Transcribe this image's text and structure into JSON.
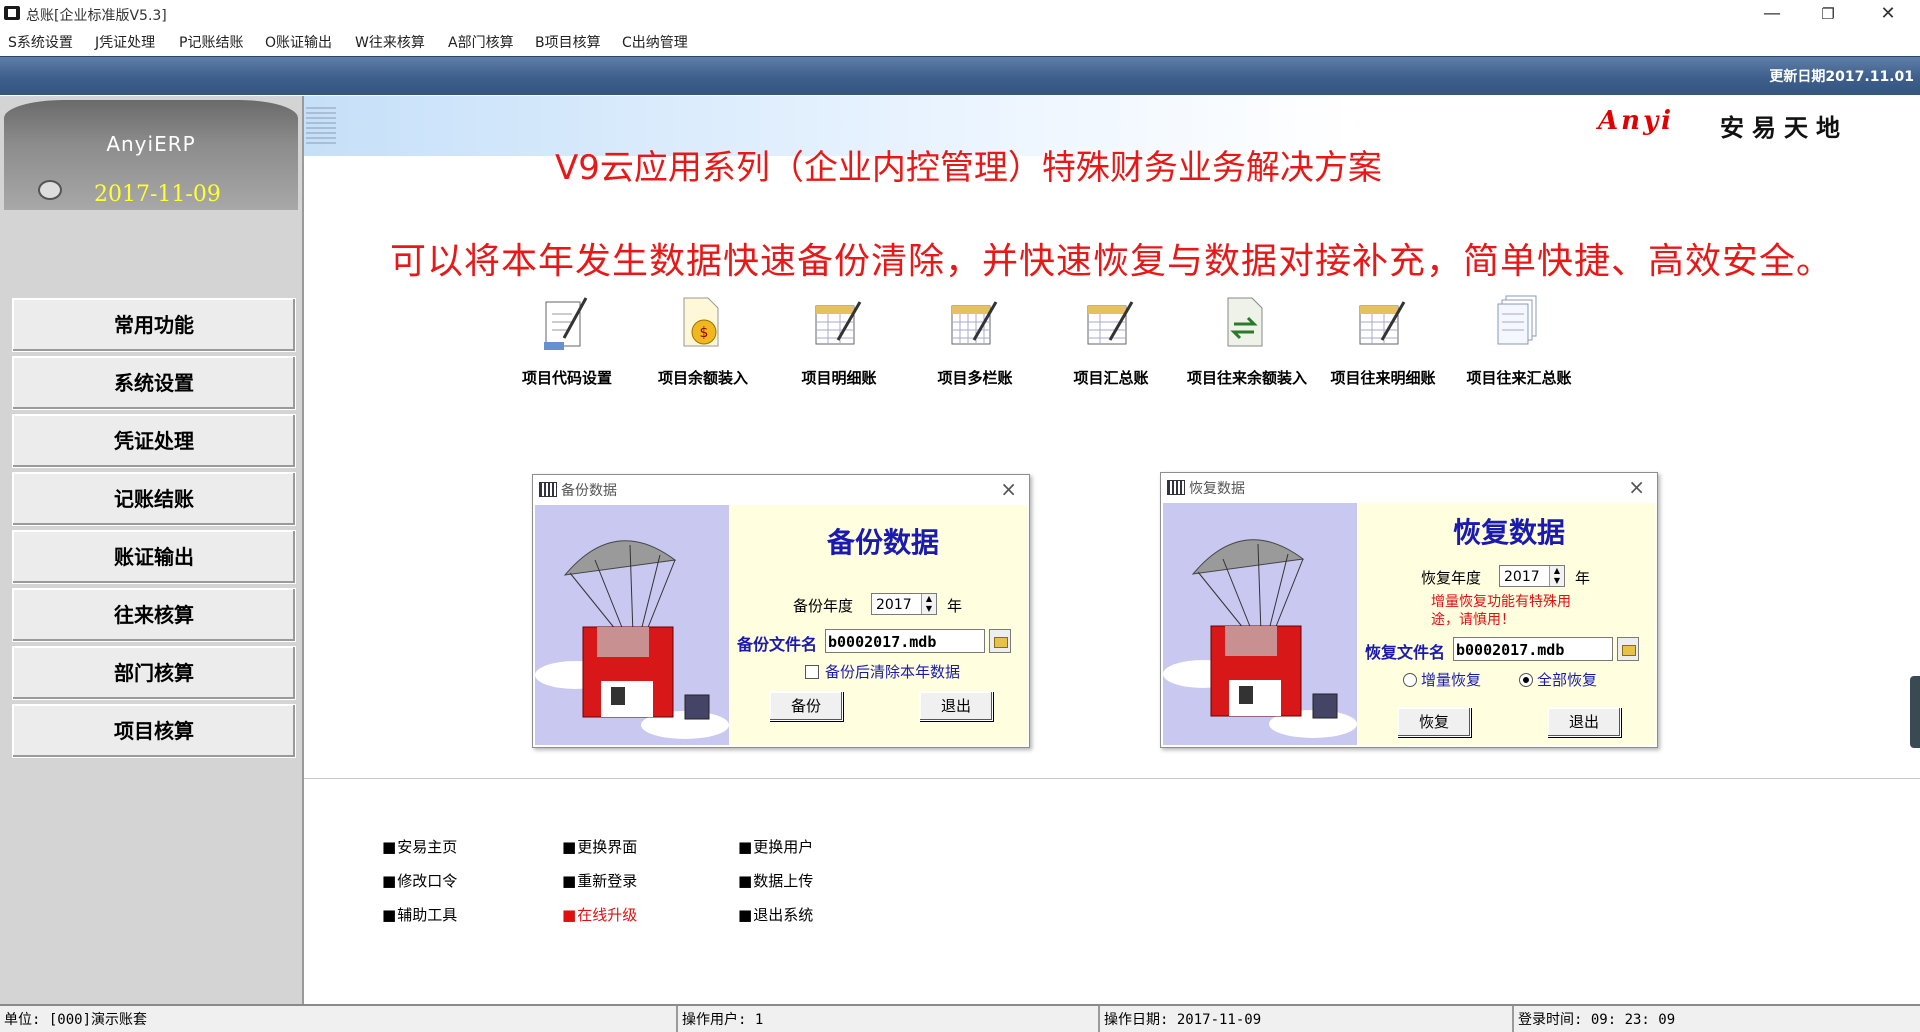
{
  "window": {
    "title": "总账[企业标准版V5.3]",
    "controls": {
      "minimize": "—",
      "restore": "❐",
      "close": "✕"
    }
  },
  "menu": [
    "S系统设置",
    "J凭证处理",
    "P记账结账",
    "O账证输出",
    "W往来核算",
    "A部门核算",
    "B项目核算",
    "C出纳管理"
  ],
  "header": {
    "update_date": "更新日期2017.11.01"
  },
  "sidebar": {
    "brand": "AnyiERP",
    "date": "2017-11-09",
    "items": [
      "常用功能",
      "系统设置",
      "凭证处理",
      "记账结账",
      "账证输出",
      "往来核算",
      "部门核算",
      "项目核算"
    ]
  },
  "banner": {
    "logo_en": "Anyi",
    "logo_cn": "安易天地",
    "headline": "V9云应用系列（企业内控管理）特殊财务业务解决方案",
    "subline": "可以将本年发生数据快速备份清除，并快速恢复与数据对接补充，简单快捷、高效安全。"
  },
  "functions": [
    {
      "label": "项目代码设置",
      "icon": "edit-document-icon"
    },
    {
      "label": "项目余额装入",
      "icon": "money-document-icon"
    },
    {
      "label": "项目明细账",
      "icon": "ledger-icon"
    },
    {
      "label": "项目多栏账",
      "icon": "multi-column-ledger-icon"
    },
    {
      "label": "项目汇总账",
      "icon": "summary-ledger-icon"
    },
    {
      "label": "项目往来余额装入",
      "icon": "transfer-document-icon"
    },
    {
      "label": "项目往来明细账",
      "icon": "ledger-icon"
    },
    {
      "label": "项目往来汇总账",
      "icon": "stacked-documents-icon"
    }
  ],
  "backup_dialog": {
    "title": "备份数据",
    "heading": "备份数据",
    "year_label": "备份年度",
    "year_value": "2017",
    "year_unit": "年",
    "file_label": "备份文件名",
    "file_value": "b0002017.mdb",
    "clear_checkbox": "备份后清除本年数据",
    "ok_button": "备份",
    "exit_button": "退出"
  },
  "restore_dialog": {
    "title": "恢复数据",
    "heading": "恢复数据",
    "year_label": "恢复年度",
    "year_value": "2017",
    "year_unit": "年",
    "warning_line1": "增量恢复功能有特殊用",
    "warning_line2": "途，请慎用！",
    "file_label": "恢复文件名",
    "file_value": "b0002017.mdb",
    "radio_incremental": "增量恢复",
    "radio_full": "全部恢复",
    "ok_button": "恢复",
    "exit_button": "退出"
  },
  "bottom_links": {
    "col1": [
      "安易主页",
      "修改口令",
      "辅助工具"
    ],
    "col2": [
      "更换界面",
      "重新登录",
      "在线升级"
    ],
    "col3": [
      "更换用户",
      "数据上传",
      "退出系统"
    ]
  },
  "status": {
    "unit": "单位: [000]演示账套",
    "user": "操作用户: 1",
    "op_date": "操作日期: 2017-11-09",
    "login_time": "登录时间: 09: 23: 09"
  },
  "colors": {
    "headline_red": "#e81818",
    "dialog_heading_blue": "#1a1ab0",
    "header_blue": "#3e5f8c"
  }
}
